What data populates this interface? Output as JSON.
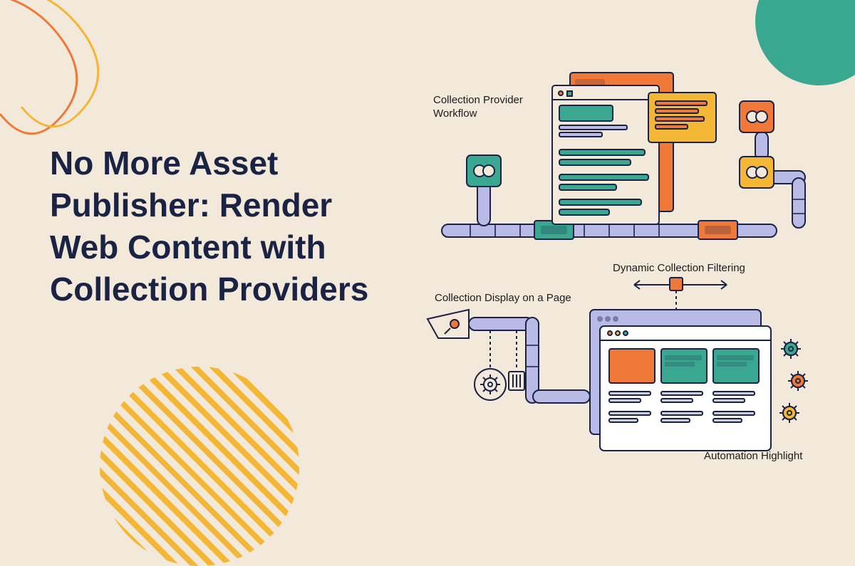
{
  "headline": "No More Asset Publisher: Render Web Content with Collection Providers",
  "labels": {
    "workflow": "Collection Provider Workflow",
    "display": "Collection Display on a Page",
    "filter": "Dynamic Collection Filtering",
    "automation": "Automation Highlight"
  },
  "palette": {
    "bg": "#f3e9da",
    "navy": "#1a2344",
    "teal": "#3aa891",
    "orange": "#f07838",
    "amber": "#f4b635",
    "lilac": "#b9bbe6"
  }
}
